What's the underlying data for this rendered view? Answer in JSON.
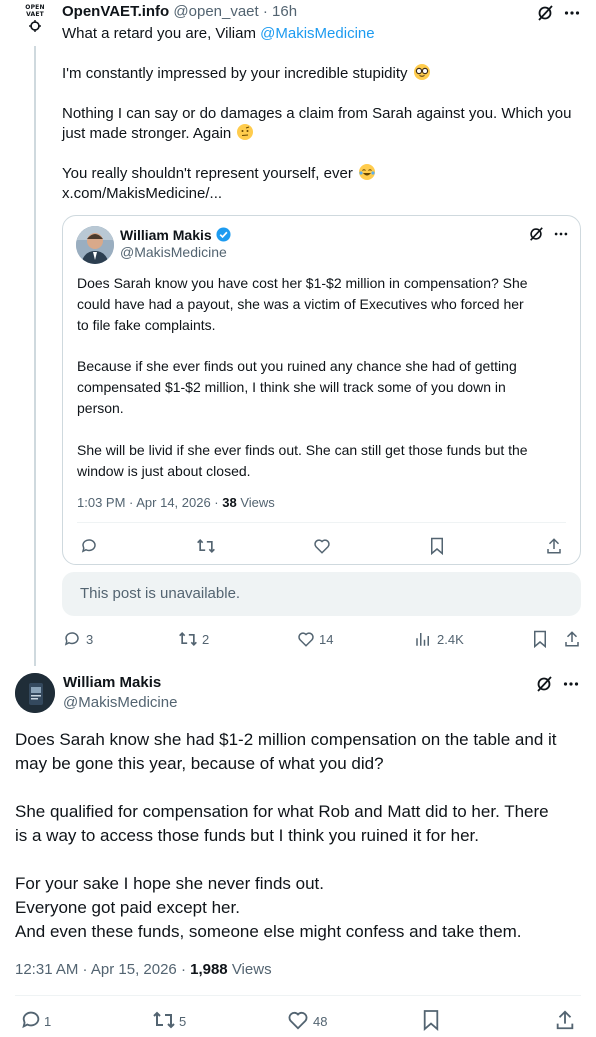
{
  "tweet1": {
    "logo_line1": "OPEN",
    "logo_line2": "VAET",
    "name": "OpenVAET.info",
    "handle": "@open_vaet",
    "sep": " · ",
    "time": "16h",
    "line1_pre": "What a retard you are, Viliam ",
    "line1_mention": "@MakisMedicine",
    "line2": "I'm constantly impressed by your incredible stupidity",
    "line3": "Nothing I can say or do damages a claim from Sarah against you. Which you",
    "line4": "just made stronger. Again",
    "line5": "You really shouldn't represent yourself, ever",
    "link": "x.com/MakisMedicine/...",
    "quote": {
      "name": "William Makis",
      "handle": "@MakisMedicine",
      "p1": [
        "Does Sarah know you have cost her $1-$2 million in compensation? She",
        "could have had a payout, she was a victim of Executives who forced her",
        "to file fake complaints."
      ],
      "p2": [
        "Because if she ever finds out you ruined any chance she had of getting",
        "compensated $1-$2 million, I think she will track some of you down in",
        "person."
      ],
      "p3": [
        "She will be livid if she ever finds out. She can still get those funds but the",
        "window is just about closed."
      ],
      "timestamp": "1:03 PM · Apr 14, 2026 · ",
      "views_count": "38",
      "views_label": " Views"
    },
    "unavailable": "This post is unavailable.",
    "metrics": {
      "replies": "3",
      "reposts": "2",
      "likes": "14",
      "views": "2.4K"
    }
  },
  "tweet2": {
    "name": "William Makis",
    "handle": "@MakisMedicine",
    "p1": [
      "Does Sarah know she had $1-2 million compensation on the table and it",
      "may be gone this year, because of what you did?"
    ],
    "p2": [
      "She qualified for compensation for what Rob and Matt did to her.  There",
      "is a way to access those funds but I think you ruined it for her."
    ],
    "p3": [
      "For your sake I hope she never finds out.",
      "Everyone got paid except her.",
      "And even these funds, someone else might confess and take them."
    ],
    "timestamp": "12:31 AM · Apr 15, 2026 · ",
    "views_count": "1,988",
    "views_label": " Views",
    "metrics": {
      "replies": "1",
      "reposts": "5",
      "likes": "48"
    }
  },
  "colors": {
    "link": "#1d9bf0",
    "verified": "#1d9bf0",
    "text": "#0f1419",
    "muted": "#536471",
    "border": "#cfd9de"
  },
  "icons": [
    "grok-icon",
    "more-icon",
    "reply-icon",
    "repost-icon",
    "like-icon",
    "views-icon",
    "bookmark-icon",
    "share-icon",
    "verified-badge-icon"
  ]
}
